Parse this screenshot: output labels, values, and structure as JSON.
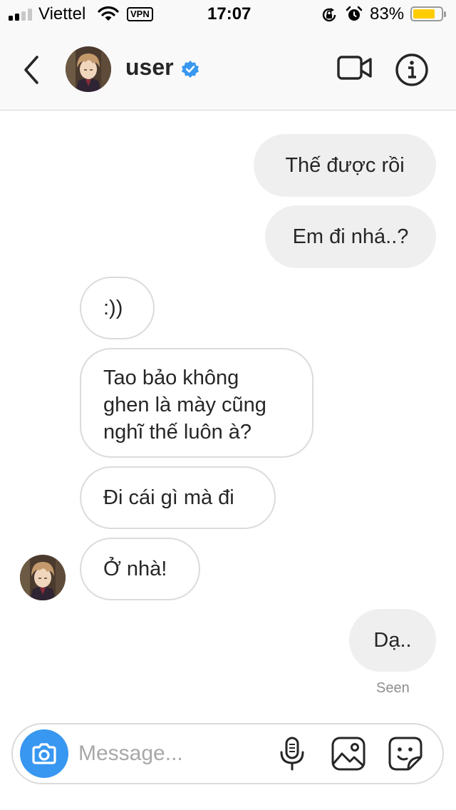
{
  "status_bar": {
    "carrier": "Viettel",
    "vpn_label": "VPN",
    "time": "17:07",
    "battery_percent": "83%",
    "battery_level": 0.83,
    "signal_bars_active": 2,
    "signal_bars_total": 4,
    "icons": [
      "wifi-icon",
      "rotation-lock-icon",
      "alarm-icon",
      "battery-icon"
    ]
  },
  "header": {
    "username": "user",
    "verified": true,
    "icons": [
      "back-chevron-icon",
      "verified-badge-icon",
      "video-call-icon",
      "info-icon"
    ]
  },
  "messages": [
    {
      "direction": "outgoing",
      "text": "Thế được rồi"
    },
    {
      "direction": "outgoing",
      "text": "Em đi nhá..?"
    },
    {
      "direction": "incoming",
      "text": ":))"
    },
    {
      "direction": "incoming",
      "lines": [
        "Tao bảo không",
        "ghen là mày cũng",
        "nghĩ thế luôn à?"
      ]
    },
    {
      "direction": "incoming",
      "text": "Đi cái gì mà đi"
    },
    {
      "direction": "incoming",
      "text": "Ở nhà!"
    },
    {
      "direction": "outgoing",
      "text": "Dạ.."
    }
  ],
  "seen_label": "Seen",
  "composer": {
    "placeholder": "Message...",
    "icons": [
      "camera-icon",
      "microphone-icon",
      "gallery-icon",
      "sticker-icon"
    ]
  },
  "colors": {
    "accent_blue": "#3897f0",
    "outgoing_bubble": "#efefef",
    "incoming_border": "#dbdbdb",
    "battery_fill": "#ffcc00"
  }
}
